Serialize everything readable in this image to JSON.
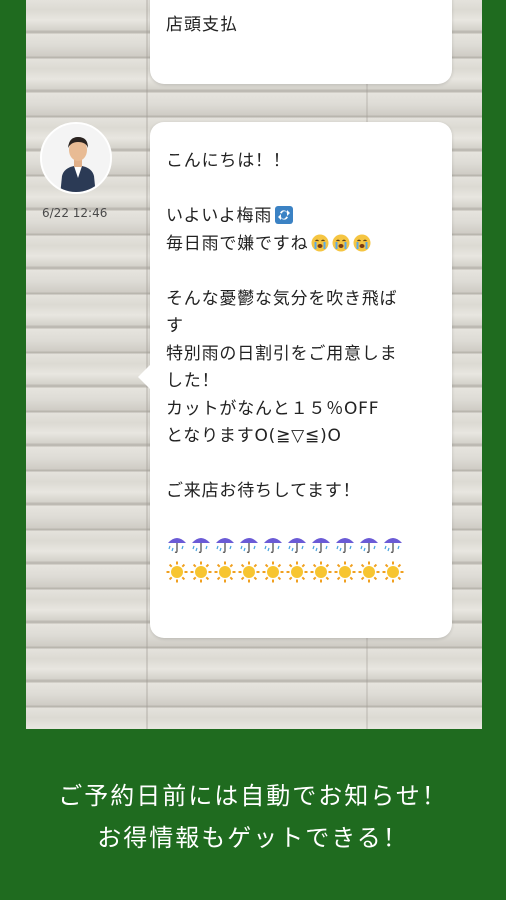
{
  "previous_message": {
    "text": "店頭支払"
  },
  "message": {
    "timestamp": "6/22 12:46",
    "avatar_icon": "person-avatar-icon",
    "lines": [
      "こんにちは！！",
      "",
      "いよいよ梅雨",
      "毎日雨で嫌ですね",
      "",
      "そんな憂鬱な気分を吹き飛ば",
      "す",
      "特別雨の日割引をご用意しま",
      "した！",
      "カットがなんと１５％OFF",
      "となりますO(≧▽≦)O",
      "",
      "ご来店お待ちしてます！"
    ],
    "umbrella_emoji_count": 10,
    "sun_emoji_count": 10,
    "colors": {
      "bubble": "#ffffff",
      "arrow_icon": "#3b82c4",
      "crying_face": "#f5c542"
    }
  },
  "footer": {
    "line1": "ご予約日前には自動でお知らせ！",
    "line2": "お得情報もゲットできる！"
  },
  "theme": {
    "background": "#1f6b1f",
    "footer_text": "#ffffff"
  }
}
